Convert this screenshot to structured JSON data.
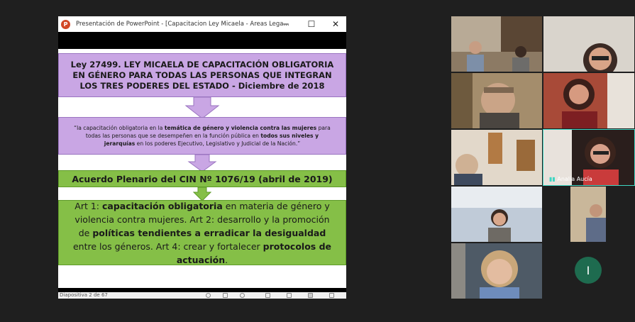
{
  "window": {
    "title": "Presentación de PowerPoint - [Capacitacion Ley Micaela - Areas Lega...",
    "app_icon": "P",
    "minimize": "─",
    "maximize": "☐",
    "close": "✕"
  },
  "slide": {
    "box1": "Ley 27499. LEY MICAELA DE CAPACITACIÓN OBLIGATORIA EN GÉNERO PARA TODAS LAS PERSONAS QUE INTEGRAN LOS TRES PODERES DEL ESTADO - Diciembre de 2018",
    "box2_parts": [
      "“la capacitación obligatoria en la ",
      "temática de género y violencia contra las mujeres",
      " para todas las personas que se desempeñen en la función pública en ",
      "todos sus niveles y jerarquías",
      " en los poderes Ejecutivo, Legislativo y Judicial de la Nación.”"
    ],
    "box3": "Acuerdo Plenario del CIN Nº 1076/19 (abril de 2019)",
    "box4_parts": [
      "Art 1: ",
      "capacitación obligatoria",
      " en materia de género y violencia contra mujeres. Art 2: desarrollo y la promoción de ",
      "políticas tendientes a erradicar la desigualdad",
      " entre los géneros. Art 4: crear y fortalecer ",
      "protocolos de actuación",
      "."
    ]
  },
  "statusbar": {
    "slide_indicator": "Diapositiva 2 de 67"
  },
  "participants": {
    "speaker_name": "Analía Aucía",
    "avatar_initial": "I"
  },
  "colors": {
    "purple": "#c9a6e4",
    "green": "#85bf47",
    "speaking": "#3fd6c3",
    "avatar": "#1e6b4f"
  }
}
